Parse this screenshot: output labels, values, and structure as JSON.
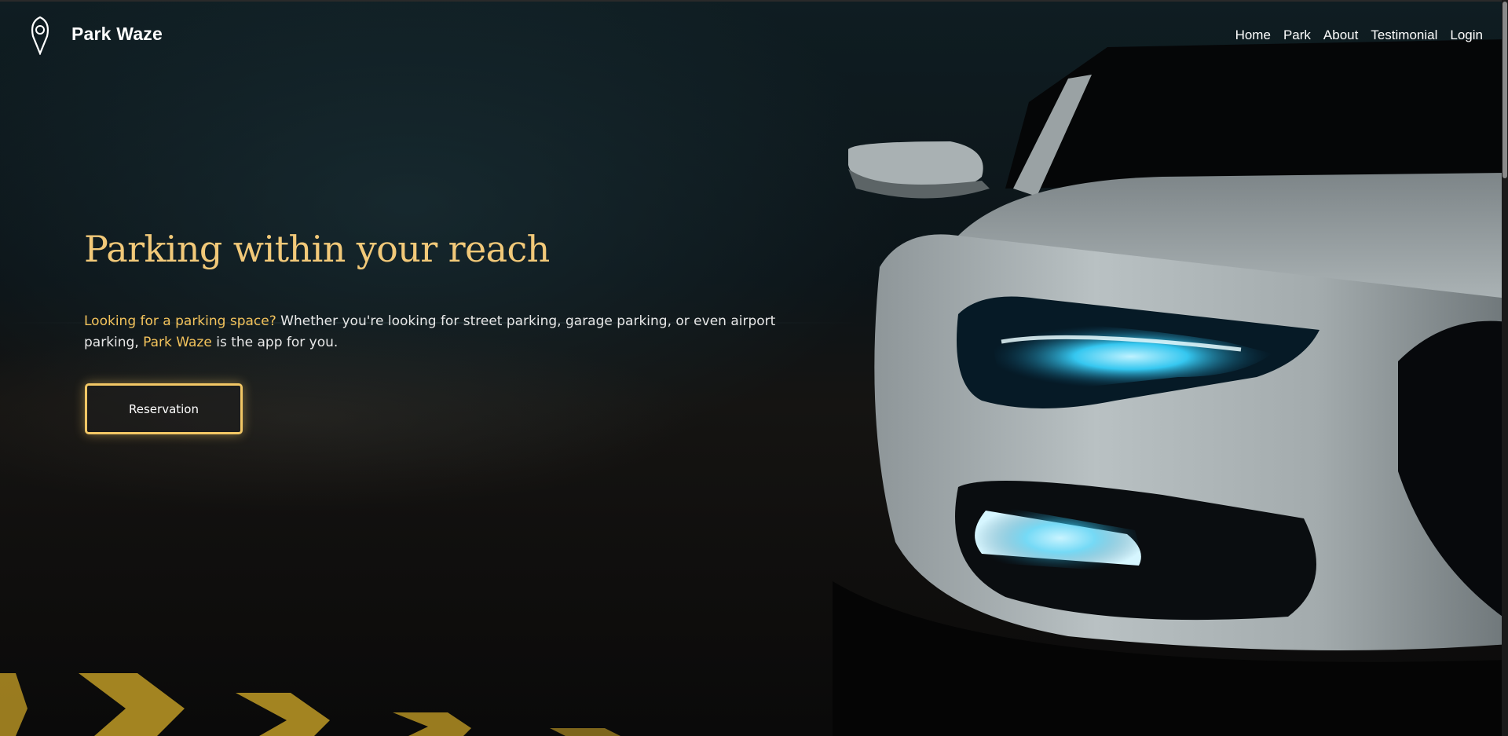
{
  "header": {
    "brand": "Park Waze",
    "logo_icon": "map-pin-icon",
    "nav": [
      {
        "label": "Home"
      },
      {
        "label": "Park"
      },
      {
        "label": "About"
      },
      {
        "label": "Testimonial"
      },
      {
        "label": "Login"
      }
    ]
  },
  "hero": {
    "title": "Parking within your reach",
    "description": {
      "part1_highlight": "Looking for a parking space?",
      "part2": " Whether you're looking for street parking, garage parking, or even airport parking, ",
      "part3_highlight": "Park Waze",
      "part4": " is the app for you."
    },
    "cta_label": "Reservation"
  },
  "colors": {
    "accent": "#f2c979",
    "highlight": "#f3c35c",
    "button_border": "#f2c765",
    "headlight": "#35c7f0"
  }
}
